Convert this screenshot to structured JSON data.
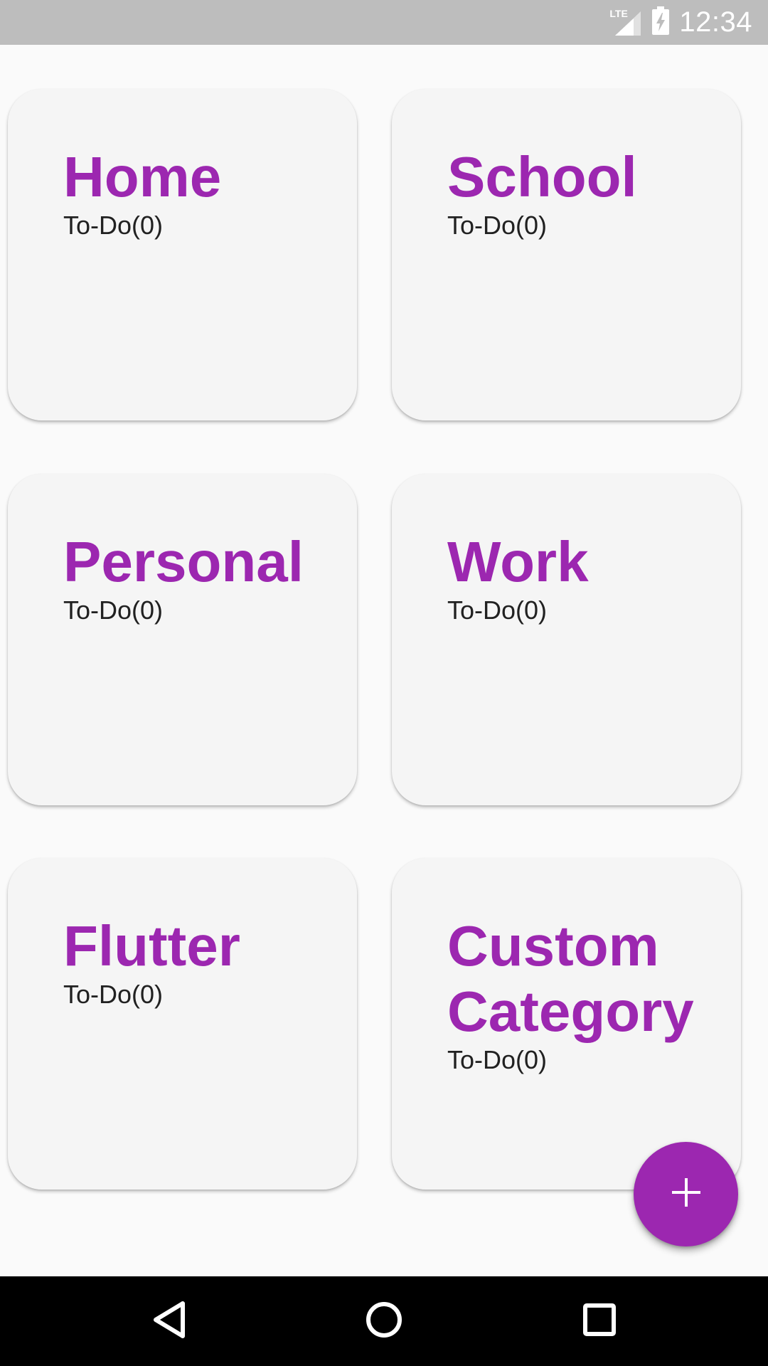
{
  "status_bar": {
    "network_label": "LTE",
    "time": "12:34"
  },
  "categories": [
    {
      "title": "Home",
      "subtitle": "To-Do(0)"
    },
    {
      "title": "School",
      "subtitle": "To-Do(0)"
    },
    {
      "title": "Personal",
      "subtitle": "To-Do(0)"
    },
    {
      "title": "Work",
      "subtitle": "To-Do(0)"
    },
    {
      "title": "Flutter",
      "subtitle": "To-Do(0)"
    },
    {
      "title": "Custom Category",
      "subtitle": "To-Do(0)"
    }
  ],
  "fab": {
    "icon": "plus-icon"
  },
  "nav_bar": {
    "icons": [
      "back-icon",
      "home-icon",
      "recents-icon"
    ]
  },
  "colors": {
    "accent": "#9c27b0",
    "card_background": "#f5f5f5",
    "page_background": "#fafafa",
    "status_bar": "#bdbdbd",
    "nav_bar": "#000000"
  }
}
